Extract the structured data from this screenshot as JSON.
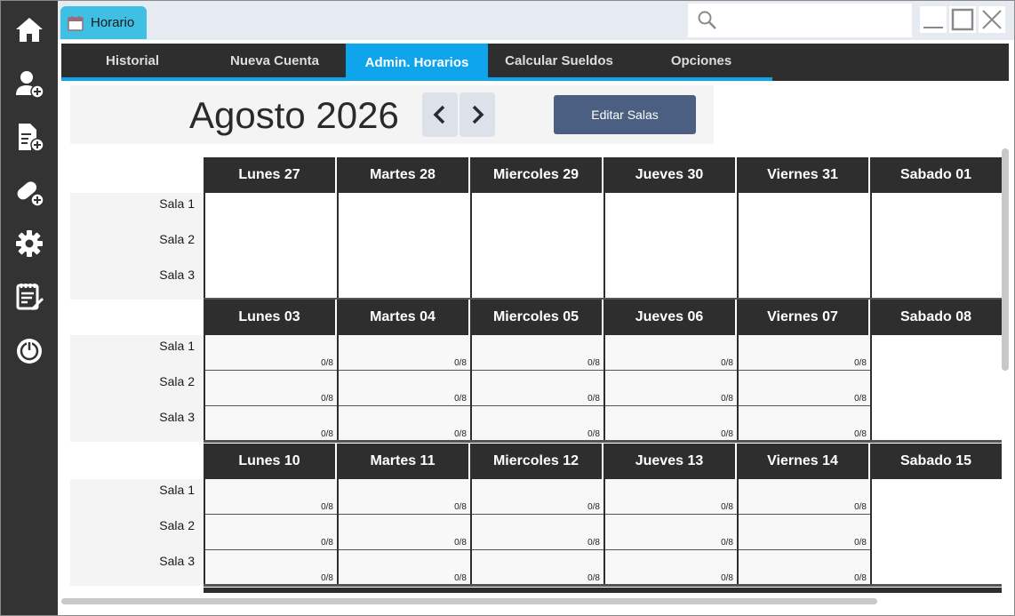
{
  "window": {
    "tab_title": "Horario"
  },
  "sidebar": {
    "items": [
      {
        "icon": "home-icon"
      },
      {
        "icon": "add-user-icon"
      },
      {
        "icon": "add-document-icon"
      },
      {
        "icon": "add-pill-icon"
      },
      {
        "icon": "gear-icon"
      },
      {
        "icon": "edit-list-icon"
      },
      {
        "icon": "power-icon"
      }
    ]
  },
  "nav": {
    "items": [
      {
        "label": "Historial"
      },
      {
        "label": "Nueva Cuenta"
      },
      {
        "label": "Admin. Horarios",
        "active": true
      },
      {
        "label": "Calcular Sueldos"
      },
      {
        "label": "Opciones"
      }
    ]
  },
  "header": {
    "month_title": "Agosto 2026",
    "edit_button": "Editar Salas"
  },
  "salas": [
    "Sala 1",
    "Sala 2",
    "Sala 3"
  ],
  "weeks": [
    {
      "days": [
        "Lunes 27",
        "Martes 28",
        "Miercoles 29",
        "Jueves 30",
        "Viernes 31",
        "Sabado 01"
      ],
      "counts": null
    },
    {
      "days": [
        "Lunes 03",
        "Martes 04",
        "Miercoles 05",
        "Jueves 06",
        "Viernes 07",
        "Sabado 08"
      ],
      "counts": [
        [
          "0/8",
          "0/8",
          "0/8"
        ],
        [
          "0/8",
          "0/8",
          "0/8"
        ],
        [
          "0/8",
          "0/8",
          "0/8"
        ],
        [
          "0/8",
          "0/8",
          "0/8"
        ],
        [
          "0/8",
          "0/8",
          "0/8"
        ]
      ]
    },
    {
      "days": [
        "Lunes 10",
        "Martes 11",
        "Miercoles 12",
        "Jueves 13",
        "Viernes 14",
        "Sabado 15"
      ],
      "counts": [
        [
          "0/8",
          "0/8",
          "0/8"
        ],
        [
          "0/8",
          "0/8",
          "0/8"
        ],
        [
          "0/8",
          "0/8",
          "0/8"
        ],
        [
          "0/8",
          "0/8",
          "0/8"
        ],
        [
          "0/8",
          "0/8",
          "0/8"
        ]
      ]
    }
  ],
  "colors": {
    "sidebar_bg": "#333333",
    "nav_bg": "#2e2e2e",
    "accent": "#0ea5ec",
    "tab": "#3fbfe1",
    "edit_button": "#4a5f82"
  }
}
